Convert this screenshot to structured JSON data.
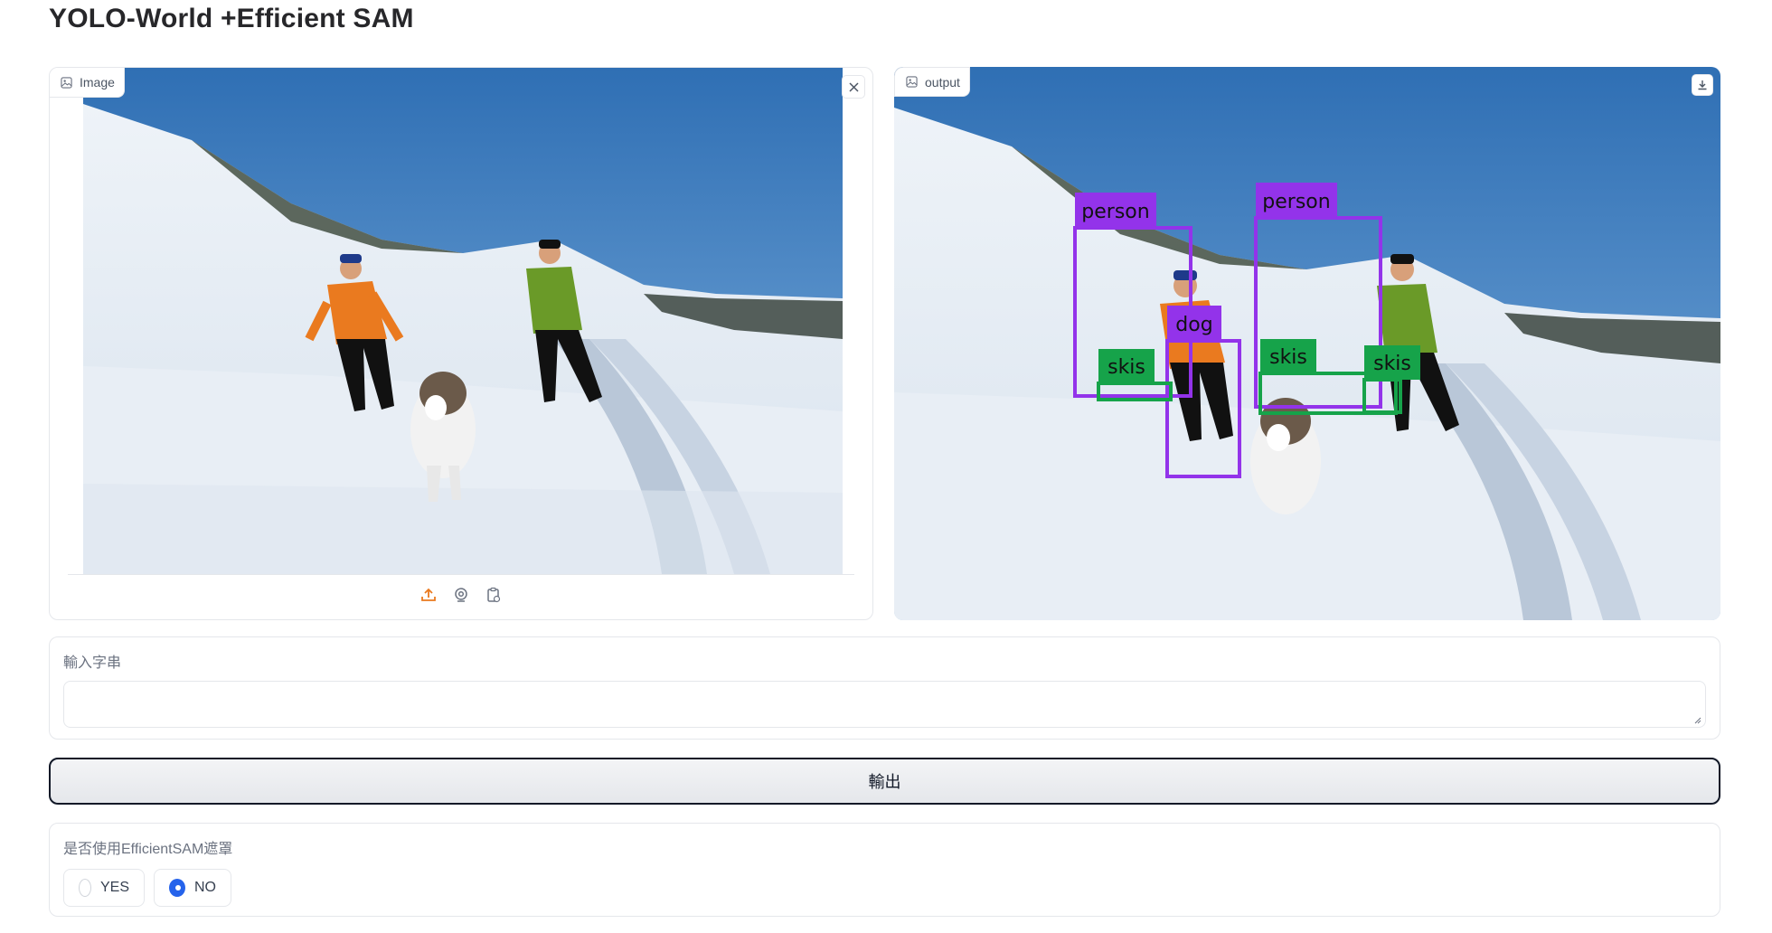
{
  "app": {
    "title": "YOLO-World +Efficient SAM"
  },
  "image_panel": {
    "label": "Image",
    "label_icon": "image-icon",
    "close_icon": "close-icon",
    "source_icons": [
      "upload-icon",
      "webcam-icon",
      "clipboard-icon"
    ]
  },
  "output_panel": {
    "label": "output",
    "label_icon": "image-icon",
    "download_icon": "download-icon",
    "detections": [
      {
        "label": "person",
        "color": "#9333ea"
      },
      {
        "label": "person",
        "color": "#9333ea"
      },
      {
        "label": "dog",
        "color": "#9333ea"
      },
      {
        "label": "skis",
        "color": "#16a34a"
      },
      {
        "label": "skis",
        "color": "#16a34a"
      },
      {
        "label": "skis",
        "color": "#16a34a"
      }
    ]
  },
  "text_input": {
    "label": "輸入字串",
    "value": "",
    "placeholder": ""
  },
  "submit": {
    "label": "輸出"
  },
  "mask_option": {
    "label": "是否使用EfficientSAM遮罩",
    "options": [
      {
        "label": "YES",
        "checked": false
      },
      {
        "label": "NO",
        "checked": true
      }
    ]
  },
  "colors": {
    "accent": "#2563eb",
    "person_box": "#9333ea",
    "skis_box": "#16a34a"
  }
}
